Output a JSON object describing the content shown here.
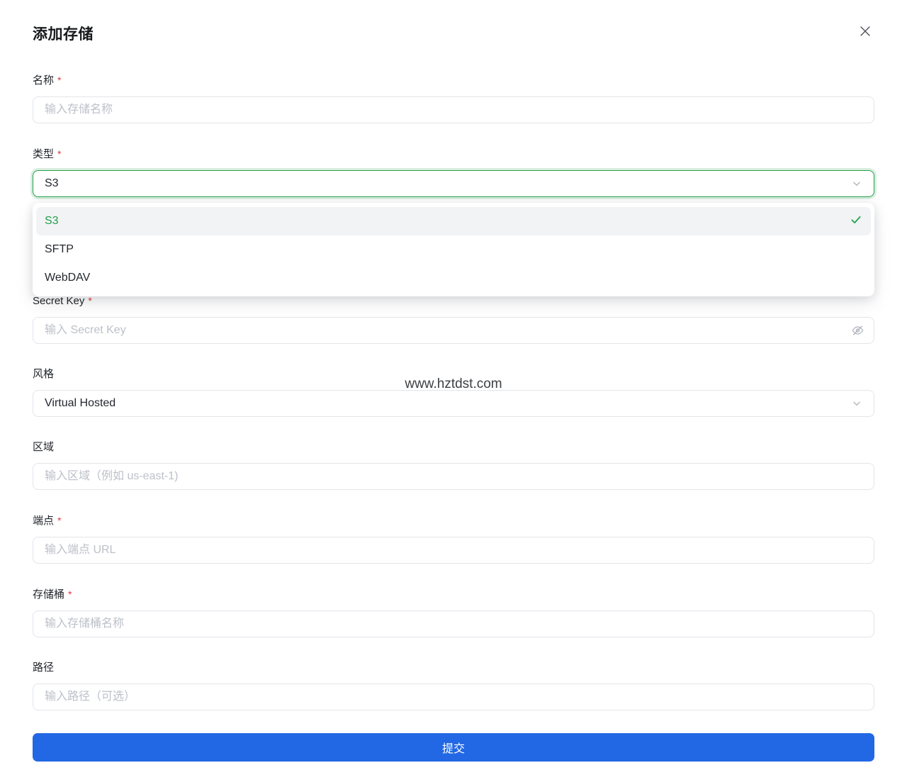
{
  "dialog": {
    "title": "添加存储"
  },
  "watermark": "www.hztdst.com",
  "form": {
    "required_marker": "*",
    "name": {
      "label": "名称",
      "required": true,
      "placeholder": "输入存储名称",
      "value": ""
    },
    "type": {
      "label": "类型",
      "required": true,
      "value": "S3",
      "dropdown_open": true,
      "options": [
        {
          "label": "S3",
          "selected": true
        },
        {
          "label": "SFTP",
          "selected": false
        },
        {
          "label": "WebDAV",
          "selected": false
        }
      ]
    },
    "secret_key": {
      "label": "Secret Key",
      "required": true,
      "placeholder": "输入 Secret Key",
      "value": ""
    },
    "style": {
      "label": "风格",
      "required": false,
      "value": "Virtual Hosted"
    },
    "region": {
      "label": "区域",
      "required": false,
      "placeholder": "输入区域（例如 us-east-1)",
      "value": ""
    },
    "endpoint": {
      "label": "端点",
      "required": true,
      "placeholder": "输入端点 URL",
      "value": ""
    },
    "bucket": {
      "label": "存储桶",
      "required": true,
      "placeholder": "输入存储桶名称",
      "value": ""
    },
    "path": {
      "label": "路径",
      "required": false,
      "placeholder": "输入路径（可选）",
      "value": ""
    },
    "submit_label": "提交"
  },
  "icons": {
    "close": "x-close",
    "chevron_down": "chevron-down",
    "check": "check",
    "eye_off": "eye-off"
  },
  "colors": {
    "accent_green": "#28a24c",
    "option_green": "#23a14d",
    "primary_blue": "#2268e5",
    "required_red": "#e0393e",
    "border_gray": "#e3e5ea",
    "placeholder_gray": "#bcc0c9",
    "selected_row_bg": "#f2f3f5"
  }
}
